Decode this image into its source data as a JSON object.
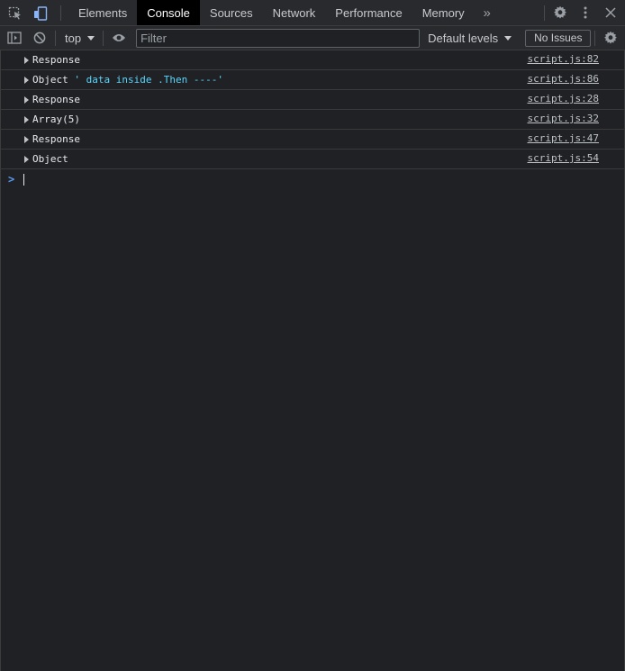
{
  "tabs": [
    {
      "label": "Elements"
    },
    {
      "label": "Console"
    },
    {
      "label": "Sources"
    },
    {
      "label": "Network"
    },
    {
      "label": "Performance"
    },
    {
      "label": "Memory"
    }
  ],
  "active_tab": "Console",
  "toolbar": {
    "context": "top",
    "filter_placeholder": "Filter",
    "filter_value": "",
    "levels": "Default levels",
    "issues": "No Issues"
  },
  "messages": [
    {
      "text": "Response",
      "string": "",
      "source": "script.js:82"
    },
    {
      "text": "Object",
      "string": " ' data inside .Then ----'",
      "source": "script.js:86"
    },
    {
      "text": "Response",
      "string": "",
      "source": "script.js:28"
    },
    {
      "text": "Array(5)",
      "string": "",
      "source": "script.js:32"
    },
    {
      "text": "Response",
      "string": "",
      "source": "script.js:47"
    },
    {
      "text": "Object",
      "string": "",
      "source": "script.js:54"
    }
  ],
  "prompt": ">",
  "colors": {
    "background": "#202124",
    "toolbar": "#292a2d",
    "active_tab": "#000000",
    "string_value": "#5cd5fb",
    "prompt": "#5b9bf5"
  }
}
